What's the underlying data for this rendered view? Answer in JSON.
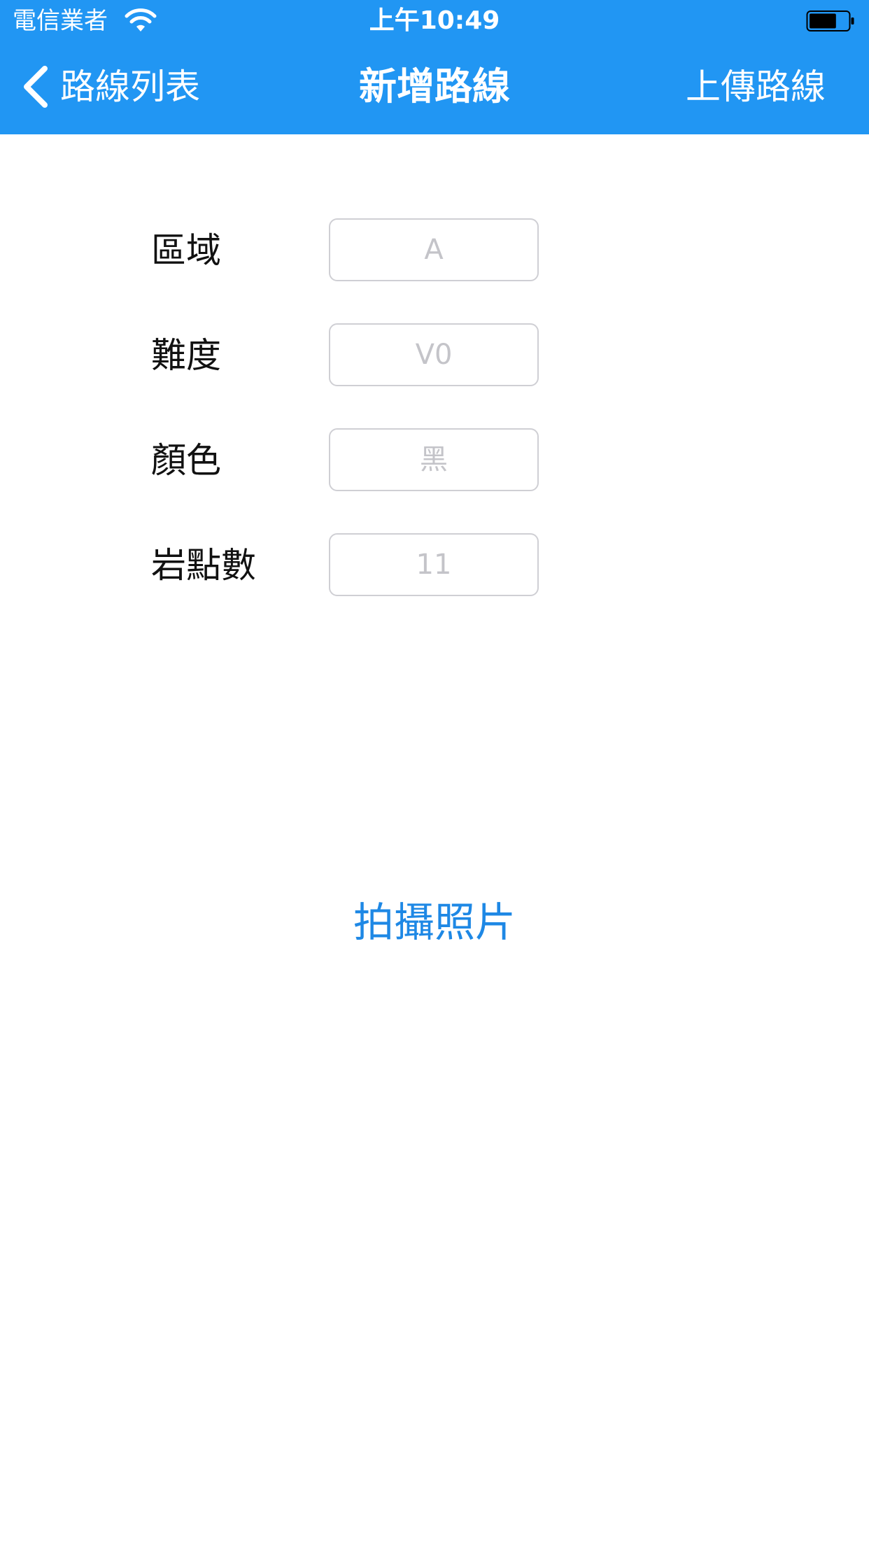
{
  "status_bar": {
    "carrier": "電信業者",
    "time": "上午10:49",
    "battery_level": 0.7
  },
  "nav_bar": {
    "back_label": "路線列表",
    "title": "新增路線",
    "upload_label": "上傳路線"
  },
  "form": {
    "fields": [
      {
        "label": "區域",
        "placeholder": "A"
      },
      {
        "label": "難度",
        "placeholder": "V0"
      },
      {
        "label": "顏色",
        "placeholder": "黑"
      },
      {
        "label": "岩點數",
        "placeholder": "11"
      }
    ]
  },
  "photo_button_label": "拍攝照片",
  "colors": {
    "nav_background": "#2196F3",
    "link_blue": "#1E88E5",
    "input_border": "#cfcfd4",
    "placeholder": "#c4c4c9"
  }
}
